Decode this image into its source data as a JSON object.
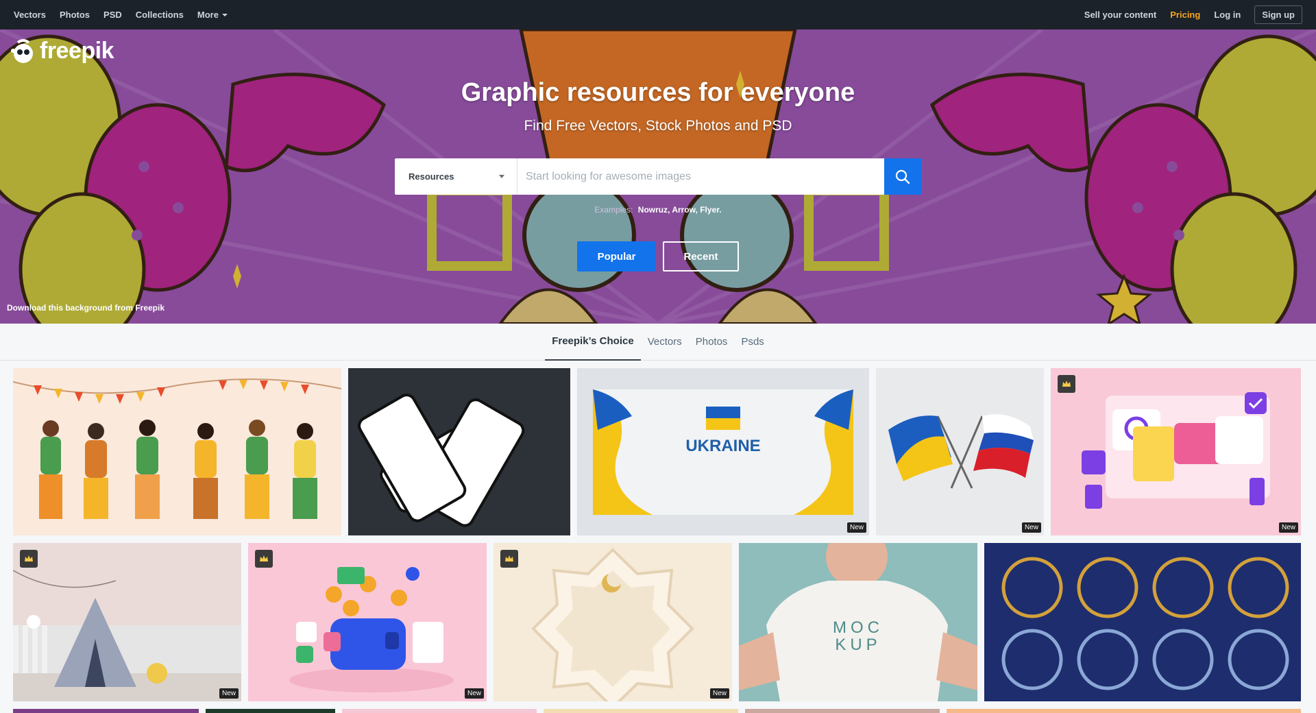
{
  "nav": {
    "left": [
      "Vectors",
      "Photos",
      "PSD",
      "Collections"
    ],
    "more": "More",
    "sell": "Sell your content",
    "pricing": "Pricing",
    "login": "Log in",
    "signup": "Sign up"
  },
  "logo": "freepik",
  "hero": {
    "title": "Graphic resources for everyone",
    "subtitle": "Find Free Vectors, Stock Photos and PSD",
    "search_select": "Resources",
    "search_placeholder": "Start looking for awesome images",
    "examples_label": "Examples:",
    "examples": "Nowruz, Arrow, Flyer.",
    "popular": "Popular",
    "recent": "Recent",
    "credit": "Download this background from Freepik"
  },
  "tabs": [
    "Freepik’s Choice",
    "Vectors",
    "Photos",
    "Psds"
  ],
  "cards": {
    "new_label": "New",
    "ukraine_text": "UKRAINE",
    "mockup_text1": "MOC",
    "mockup_text2": "KUP"
  },
  "colors": {
    "nav_bg": "#1b2229",
    "pricing": "#f5a623",
    "primary": "#1273eb"
  }
}
